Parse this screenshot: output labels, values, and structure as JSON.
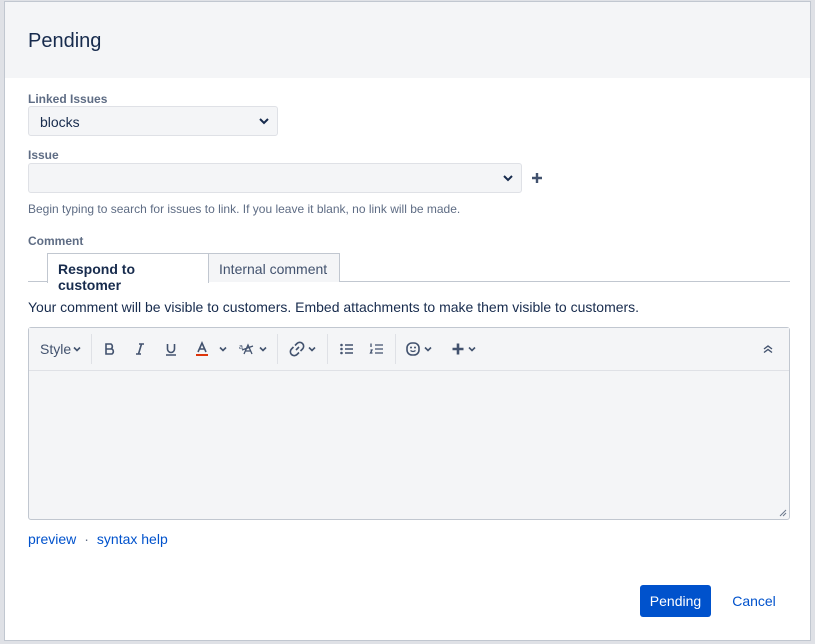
{
  "dialog": {
    "title": "Pending"
  },
  "linked_issues": {
    "label": "Linked Issues",
    "selected": "blocks"
  },
  "issue": {
    "label": "Issue",
    "value": "",
    "help": "Begin typing to search for issues to link. If you leave it blank, no link will be made."
  },
  "comment": {
    "label": "Comment",
    "tabs": [
      {
        "label": "Respond to customer",
        "active": true
      },
      {
        "label": "Internal comment",
        "active": false
      }
    ],
    "note": "Your comment will be visible to customers. Embed attachments to make them visible to customers.",
    "toolbar": {
      "style_label": "Style",
      "icons": [
        "bold-icon",
        "italic-icon",
        "underline-icon",
        "text-color-icon",
        "text-format-icon",
        "link-icon",
        "bullet-list-icon",
        "numbered-list-icon",
        "emoji-icon",
        "insert-more-icon",
        "collapse-toolbar-icon"
      ]
    },
    "body": ""
  },
  "footer_links": {
    "preview": "preview",
    "separator": "·",
    "syntax_help": "syntax help"
  },
  "actions": {
    "submit": "Pending",
    "cancel": "Cancel"
  },
  "colors": {
    "primary": "#0052cc",
    "text": "#172b4d",
    "header_bg": "#f4f5f7",
    "underline_red": "#de350b"
  }
}
